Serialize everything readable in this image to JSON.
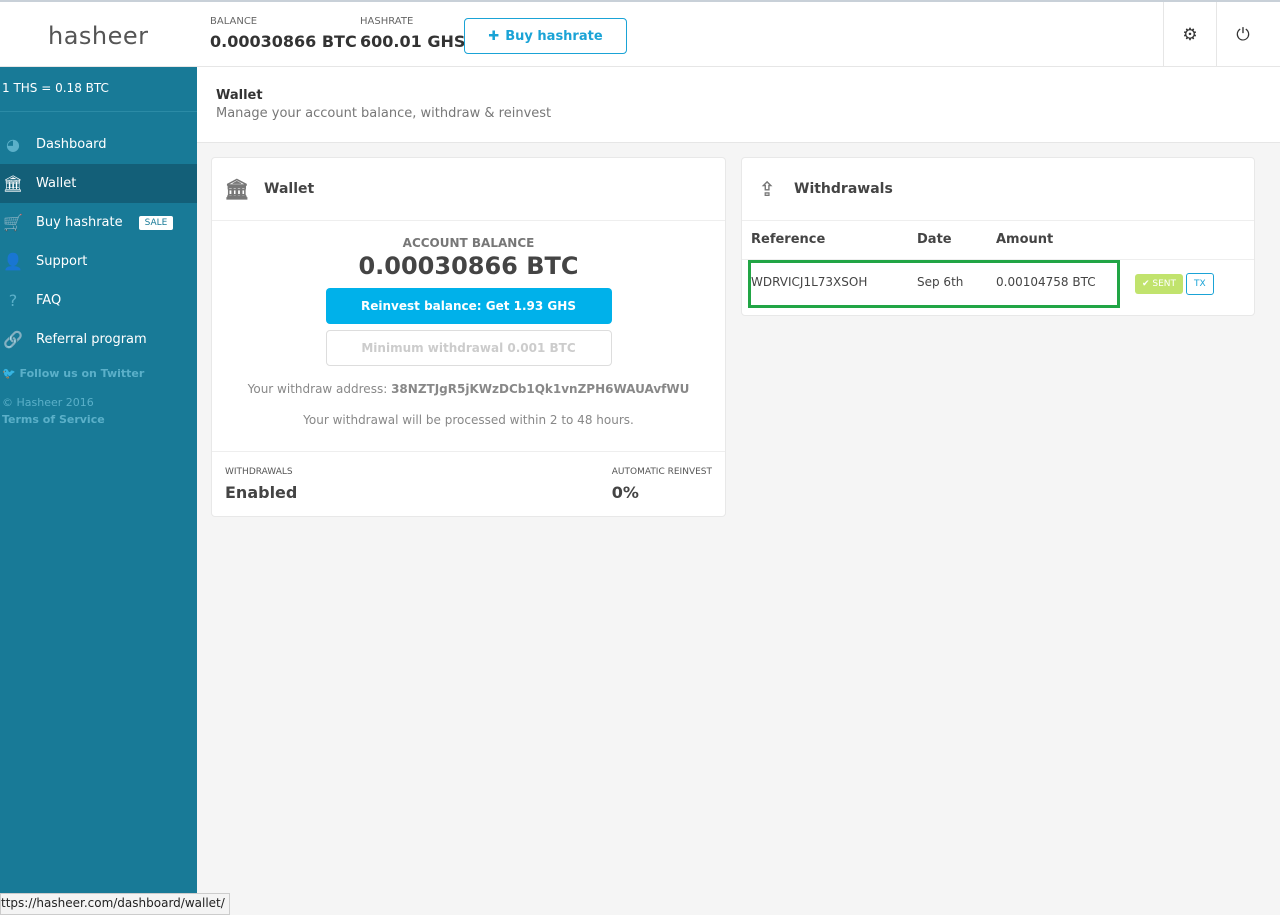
{
  "header": {
    "logo": "hasheer",
    "balance_label": "BALANCE",
    "balance_value": "0.00030866 BTC",
    "hashrate_label": "HASHRATE",
    "hashrate_value": "600.01 GHS",
    "buy_button": "Buy hashrate",
    "settings_icon": "gear-icon",
    "power_icon": "power-icon"
  },
  "sidebar": {
    "rate": "1 THS = 0.18 BTC",
    "items": [
      {
        "label": "Dashboard",
        "icon": "dashboard-icon"
      },
      {
        "label": "Wallet",
        "icon": "bank-icon",
        "active": true
      },
      {
        "label": "Buy hashrate",
        "icon": "cart-icon",
        "badge": "SALE"
      },
      {
        "label": "Support",
        "icon": "user-icon"
      },
      {
        "label": "FAQ",
        "icon": "question-icon"
      },
      {
        "label": "Referral program",
        "icon": "link-icon"
      }
    ],
    "twitter": "Follow us on Twitter",
    "copyright": "© Hasheer 2016",
    "terms": "Terms of Service"
  },
  "page": {
    "title": "Wallet",
    "subtitle": "Manage your account balance, withdraw & reinvest"
  },
  "wallet": {
    "title": "Wallet",
    "balance_label": "ACCOUNT BALANCE",
    "balance": "0.00030866 BTC",
    "reinvest_button": "Reinvest balance: Get 1.93 GHS",
    "withdraw_button": "Minimum withdrawal 0.001 BTC",
    "address_label": "Your withdraw address:",
    "address": "38NZTJgR5jKWzDCb1Qk1vnZPH6WAUAvfWU",
    "processing_note": "Your withdrawal will be processed within 2 to 48 hours.",
    "withdrawals_label": "WITHDRAWALS",
    "withdrawals_value": "Enabled",
    "auto_reinvest_label": "AUTOMATIC REINVEST",
    "auto_reinvest_value": "0%"
  },
  "withdrawals": {
    "title": "Withdrawals",
    "columns": [
      "Reference",
      "Date",
      "Amount"
    ],
    "rows": [
      {
        "reference": "WDRVICJ1L73XSOH",
        "date": "Sep 6th",
        "amount": "0.00104758 BTC",
        "status": "SENT",
        "tx": "TX"
      }
    ]
  },
  "statusbar": {
    "url": "ttps://hasheer.com/dashboard/wallet/"
  },
  "colors": {
    "sidebar": "#187a97",
    "accent": "#00b1ea",
    "highlight": "#21a545",
    "sent": "#c1e36d"
  }
}
